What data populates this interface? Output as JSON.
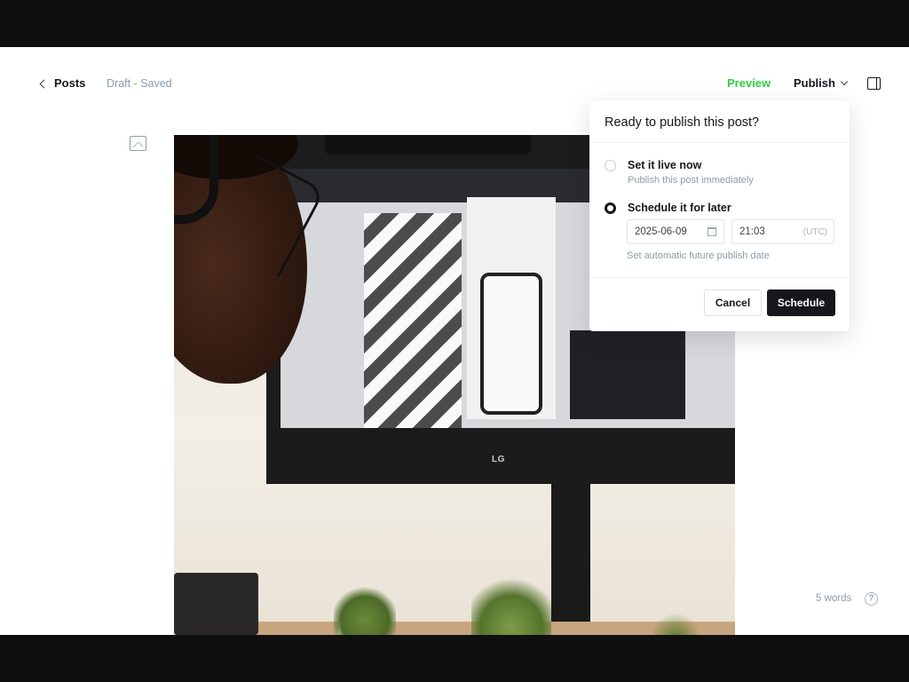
{
  "header": {
    "back_label": "Posts",
    "status": "Draft - Saved",
    "preview_label": "Preview",
    "publish_label": "Publish"
  },
  "editor": {
    "word_count": "5 words",
    "help_glyph": "?"
  },
  "publish_menu": {
    "title": "Ready to publish this post?",
    "options": [
      {
        "title": "Set it live now",
        "subtitle": "Publish this post immediately",
        "selected": false
      },
      {
        "title": "Schedule it for later",
        "selected": true
      }
    ],
    "date_value": "2025-06-09",
    "time_value": "21:03",
    "timezone": "(UTC)",
    "hint": "Set automatic future publish date",
    "cancel_label": "Cancel",
    "schedule_label": "Schedule"
  },
  "photo": {
    "monitor_logo": "LG"
  },
  "colors": {
    "accent_green": "#30cf43",
    "primary_dark": "#15171a",
    "muted_text": "#8e9cac"
  },
  "icons": [
    "chevron-left-icon",
    "chevron-down-icon",
    "sidebar-toggle-icon",
    "image-card-icon",
    "calendar-icon",
    "help-icon"
  ]
}
